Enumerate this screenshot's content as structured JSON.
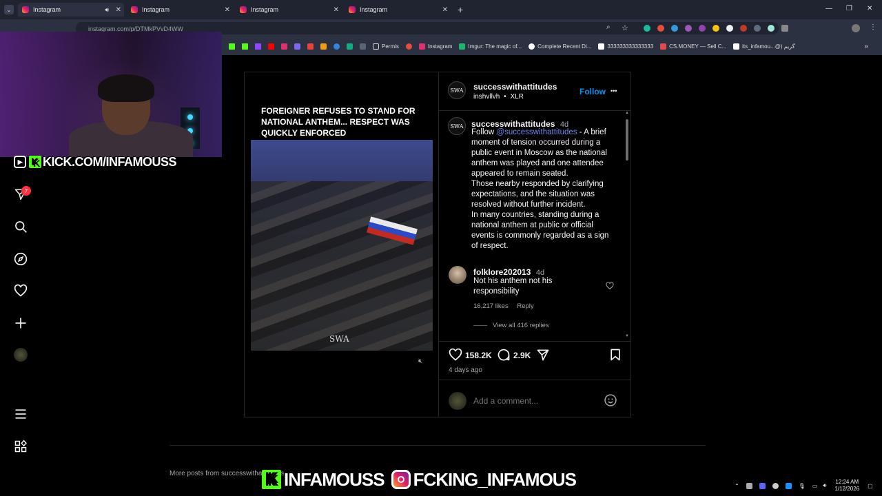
{
  "browser": {
    "tabs": [
      {
        "title": "Instagram",
        "active": true
      },
      {
        "title": "Instagram",
        "active": false
      },
      {
        "title": "Instagram",
        "active": false
      },
      {
        "title": "Instagram",
        "active": false
      }
    ],
    "new_tab": "+",
    "url": "instagram.com/p/DTMkPVvD4WW",
    "bookmarks": [
      {
        "label": "Permis",
        "color": "#cfcfcf"
      },
      {
        "label": "Instagram",
        "color": "#e1306c"
      },
      {
        "label": "Imgur: The magic of...",
        "color": "#1bb76e"
      },
      {
        "label": "Complete Recent Di...",
        "color": "#ffffff"
      },
      {
        "label": "333333333333333",
        "color": "#ffffff"
      },
      {
        "label": "CS.MONEY — Sell C...",
        "color": "#e5484d"
      },
      {
        "label": "its_infamou...@) گریم",
        "color": "#ffffff"
      }
    ],
    "window_controls": [
      "—",
      "❐",
      "✕"
    ]
  },
  "stream": {
    "kick_url": "KICK.COM/INFAMOUSS",
    "kick_letter": "K",
    "bottom_kick": "INFAMOUSS",
    "bottom_ig": "FCKING_INFAMOUS"
  },
  "nav": {
    "notification_count": "7"
  },
  "post": {
    "video_caption": "FOREIGNER REFUSES TO STAND FOR NATIONAL ANTHEM... RESPECT WAS QUICKLY ENFORCED",
    "watermark": "SWA",
    "avatar_text": "SWA",
    "author": "successwithattitudes",
    "subline_user": "inshvllvh",
    "subline_sep": "•",
    "subline_audio": "XLR",
    "follow": "Follow",
    "more": "•••",
    "caption_author": "successwithattitudes",
    "caption_age": "4d",
    "caption_follow": "Follow",
    "caption_mention": "@successwithattitudes",
    "caption_body_1": " - A brief moment of tension occurred during a public event in Moscow as the national anthem was played and one attendee appeared to remain seated.",
    "caption_body_2": "Those nearby responded by clarifying expectations, and the situation was resolved without further incident.",
    "caption_body_3": "In many countries, standing during a national anthem at public or official events is commonly regarded as a sign of respect.",
    "comment": {
      "user": "folklore202013",
      "age": "4d",
      "text": "Not his anthem not his responsibility",
      "likes": "16,217 likes",
      "reply": "Reply",
      "view_replies": "View all 416 replies"
    },
    "like_count": "158.2K",
    "comment_count": "2.9K",
    "posted": "4 days ago",
    "add_comment_placeholder": "Add a comment..."
  },
  "more_posts": "More posts from successwithattitudes",
  "taskbar": {
    "time": "12:24 AM",
    "date": "1/12/2026"
  }
}
